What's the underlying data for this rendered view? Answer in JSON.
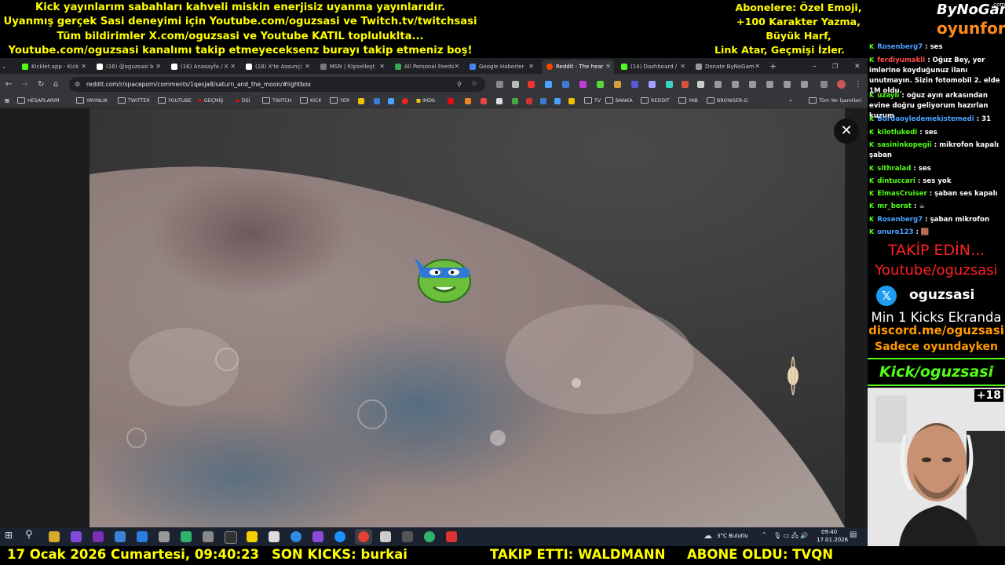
{
  "banner": {
    "lines": [
      "Kick yayınlarım sabahları kahveli miskin enerjisiz uyanma yayınlarıdır.",
      "Uyanmış gerçek Sasi deneyimi için Youtube.com/oguzsasi ve Twitch.tv/twitchsasi",
      "Tüm bildirimler X.com/oguzsasi ve Youtube KATIL topluluklta...",
      "Youtube.com/oguzsasi kanalımı takip etmeyeceksenz burayı takip etmeniz boş!"
    ],
    "subscriber_lines": [
      "Abonelere: Özel Emoji,",
      "+100 Karakter Yazma,",
      "Büyük Harf,",
      "Link Atar, Geçmişi İzler."
    ]
  },
  "browser": {
    "tabs": [
      {
        "label": "Kicklet.app - Kick",
        "color": "#53fc18"
      },
      {
        "label": "(16) @oguzsasi b",
        "color": "#ffffff"
      },
      {
        "label": "(16) Anasayfa / X",
        "color": "#ffffff"
      },
      {
        "label": "(18) X'te Assunçi",
        "color": "#ffffff"
      },
      {
        "label": "MSN | Kişiselleşt",
        "color": "#7a7a7a"
      },
      {
        "label": "All Personal Feeds",
        "color": "#34a853"
      },
      {
        "label": "Google Haberler",
        "color": "#4285f4"
      },
      {
        "label": "Reddit - The hear",
        "color": "#ff4500"
      },
      {
        "label": "(14) Dashboard /",
        "color": "#53fc18"
      },
      {
        "label": "Donate ByNoGam",
        "color": "#999999"
      }
    ],
    "active_tab_index": 7,
    "url": "reddit.com/r/spaceporn/comments/1qesja8/saturn_and_the_moon/#lightbox",
    "bookmarks": [
      "HESAPLARIM",
      "YAYINLIK",
      "TWITTER",
      "YOUTUBE",
      "GEÇMİŞ",
      "DSİ",
      "TWITCH",
      "KICK",
      "YER",
      "IMDb",
      "TV",
      "BANKA",
      "REDDIT",
      "YAB",
      "BROWSER-G"
    ],
    "all_bookmarks_label": "Tüm Yer İşaretleri",
    "close_symbol": "✕"
  },
  "taskbar": {
    "weather": "3°C  Bulutlu",
    "time": "09:40",
    "date": "17.01.2026"
  },
  "ticker": {
    "datetime": "17 Ocak 2026 Cumartesi, 09:40:23",
    "kicks": "SON KICKS: burkai",
    "follow": "TAKIP ETTI: WALDMANN",
    "subscribe": "ABONE OLDU: TVQN"
  },
  "logo": {
    "top": "ByNoGame",
    "dotcom": ".com",
    "bottom": "oyunfor"
  },
  "chat": [
    {
      "user": "Rosenberg7",
      "msg": ": ses",
      "color": "blue"
    },
    {
      "user": "ferdiyumakli",
      "msg": ": Oğuz Bey, yer imlerine koyduğunuz ilanı unutmayın. Sizin fotomobil 2. elde 1M oldu.",
      "color": "red"
    },
    {
      "user": "uzayli",
      "msg": ": oğuz ayın arkasından evine doğru geliyorum hazırlan kuzum",
      "color": "green"
    },
    {
      "user": "Burdaoyledemekistemedi",
      "msg": ": 31",
      "color": "blue"
    },
    {
      "user": "kilotlukedi",
      "msg": ": ses",
      "color": "green"
    },
    {
      "user": "sasininkopegii",
      "msg": ": mikrofon kapalı şaban",
      "color": "green"
    },
    {
      "user": "sithralad",
      "msg": ": ses",
      "color": "green"
    },
    {
      "user": "dintuccari",
      "msg": ": ses yok",
      "color": "green"
    },
    {
      "user": "ElmasCruiser",
      "msg": ": şaban ses kapalı",
      "color": "green"
    },
    {
      "user": "mr_berat",
      "msg": ": ☕",
      "color": "green"
    },
    {
      "user": "Rosenberg7",
      "msg": ": şaban mikrofon",
      "color": "blue"
    },
    {
      "user": "onuro123",
      "msg": ": 🟫",
      "color": "blue"
    }
  ],
  "promo": {
    "follow": "TAKİP EDİN...",
    "youtube": "Youtube/oguzsasi",
    "x_handle": "oguzsasi",
    "kicks_note": "Min 1 Kicks Ekranda",
    "discord": "discord.me/oguzsasi",
    "game_only": "Sadece oyundayken",
    "kick": "Kick/oguzsasi",
    "age": "+18"
  }
}
